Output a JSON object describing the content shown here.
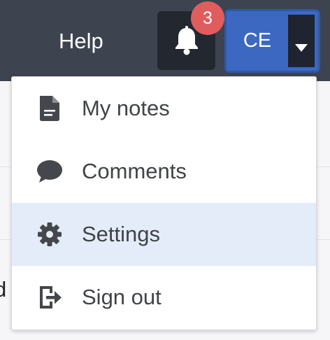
{
  "header": {
    "help_label": "Help",
    "notifications_count": "3",
    "user_initials": "CE"
  },
  "menu": {
    "items": [
      {
        "label": "My notes",
        "icon": "document-icon"
      },
      {
        "label": "Comments",
        "icon": "speech-bubble-icon"
      },
      {
        "label": "Settings",
        "icon": "gear-icon",
        "active": true
      },
      {
        "label": "Sign out",
        "icon": "sign-out-icon"
      }
    ]
  },
  "background": {
    "partial_text": "d"
  },
  "colors": {
    "topbar": "#3d434f",
    "badge": "#e05d5d",
    "user_button": "#3d68c2",
    "menu_active": "#e3ecf8"
  }
}
